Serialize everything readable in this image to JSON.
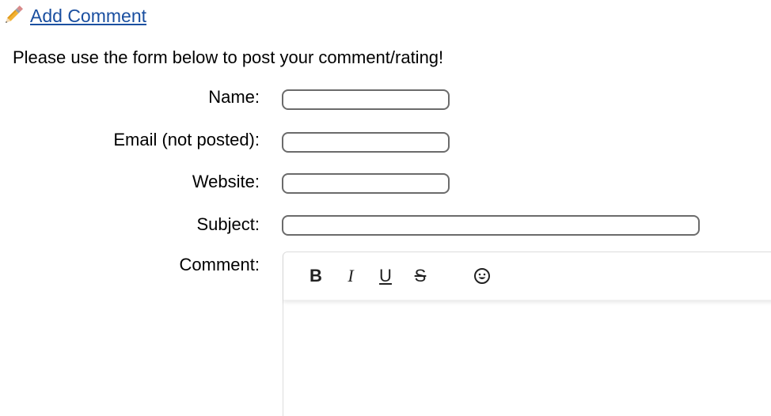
{
  "add_comment": {
    "label": " Add Comment",
    "icon": "pencil-icon"
  },
  "intro_text": "Please use the form below to post your comment/rating!",
  "form": {
    "name": {
      "label": "Name:",
      "value": ""
    },
    "email": {
      "label": "Email (not posted):",
      "value": ""
    },
    "website": {
      "label": "Website:",
      "value": ""
    },
    "subject": {
      "label": "Subject:",
      "value": ""
    },
    "comment": {
      "label": "Comment:",
      "toolbar": {
        "bold": "B",
        "italic": "I",
        "underline": "U",
        "strike": "S",
        "emoji_icon": "smiley-icon"
      }
    }
  },
  "colors": {
    "link": "#1a4fa0",
    "input_border": "#6b6b6b",
    "editor_border": "#dddddd"
  }
}
